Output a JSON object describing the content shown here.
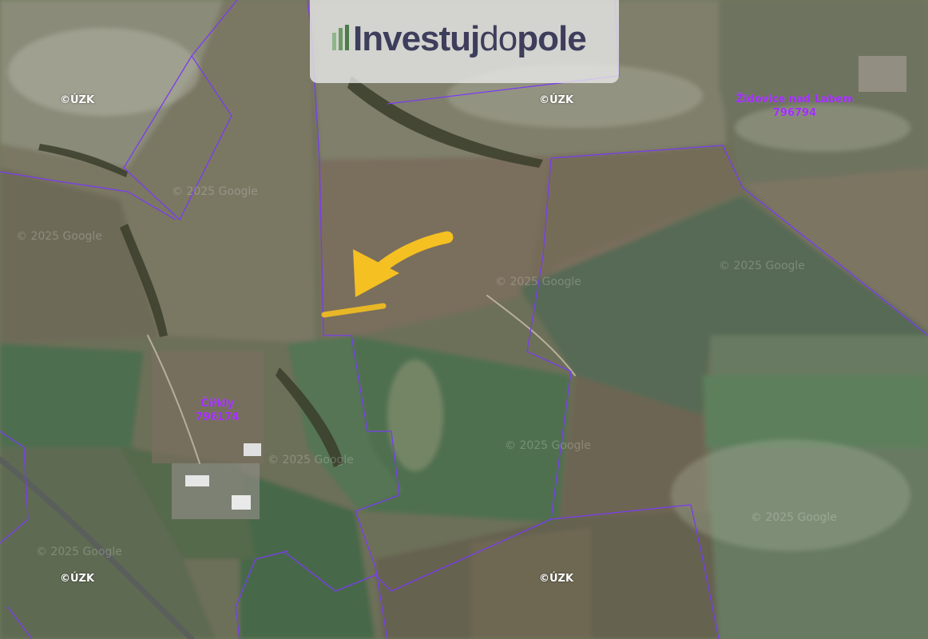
{
  "brand": {
    "prefix": "Investuj",
    "middle": "do",
    "suffix": "pole",
    "text_color": "#3d3d5c",
    "panel_color": "#ebebeb"
  },
  "map": {
    "type": "satellite cadastral map",
    "parcel_line_color": "#7a3cf0",
    "highlight_color": "#f5c021",
    "arrow_color": "#f5c021",
    "copyright_label": "©ÚZK",
    "watermark_text": "© 2025 Google",
    "places": [
      {
        "name": "Židovice nad Labem",
        "code": "796794"
      },
      {
        "name": "Čířkly",
        "code": "796174"
      }
    ]
  }
}
